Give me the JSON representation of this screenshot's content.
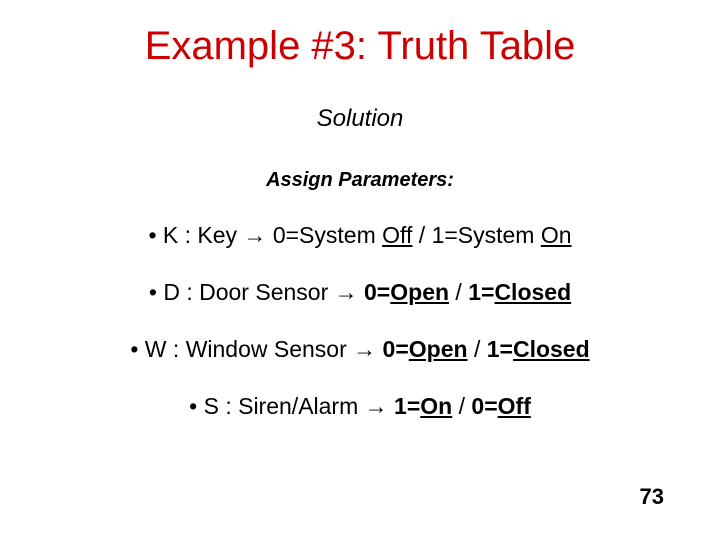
{
  "title": "Example #3: Truth Table",
  "subtitle": "Solution",
  "section_heading": "Assign Parameters:",
  "params": [
    {
      "sym": "K",
      "name": "Key",
      "zero_prefix": "0=System ",
      "zero_u": "Off",
      "one_prefix": "1=System ",
      "one_u": "On"
    },
    {
      "sym": "D",
      "name": "Door Sensor",
      "zero_prefix": "0=",
      "zero_u": "Open",
      "one_prefix": "1=",
      "one_u": "Closed"
    },
    {
      "sym": "W",
      "name": "Window Sensor",
      "zero_prefix": "0=",
      "zero_u": "Open",
      "one_prefix": "1=",
      "one_u": "Closed"
    },
    {
      "sym": "S",
      "name": "Siren/Alarm",
      "first_prefix": "1=",
      "first_u": "On",
      "second_prefix": "0=",
      "second_u": "Off"
    }
  ],
  "page_number": "73"
}
